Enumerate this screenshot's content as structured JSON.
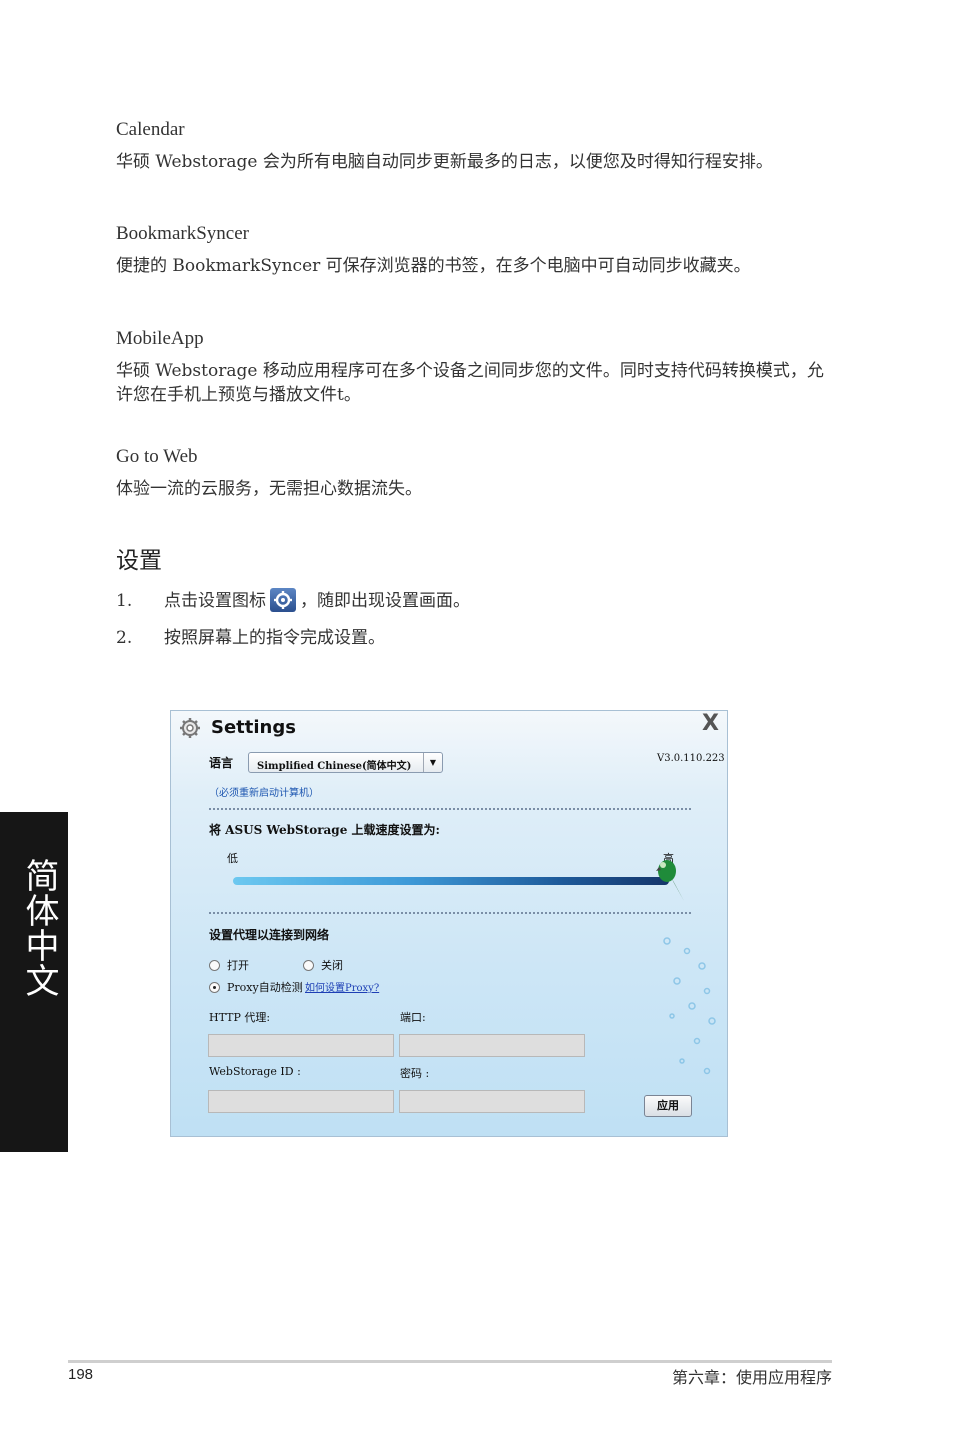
{
  "sections": [
    {
      "title": "Calendar",
      "body": "华硕 Webstorage 会为所有电脑自动同步更新最多的日志，以便您及时得知行程安排。"
    },
    {
      "title": "BookmarkSyncer",
      "body": "便捷的 BookmarkSyncer 可保存浏览器的书签，在多个电脑中可自动同步收藏夹。"
    },
    {
      "title": "MobileApp",
      "body": "华硕 Webstorage 移动应用程序可在多个设备之间同步您的文件。同时支持代码转换模式，允许您在手机上预览与播放文件t。"
    },
    {
      "title": "Go to Web",
      "body": "体验一流的云服务，无需担心数据流失。"
    }
  ],
  "settings_heading": "设置",
  "steps": [
    {
      "num": "1.",
      "before": "点击设置图标",
      "after": "，随即出现设置画面。"
    },
    {
      "num": "2.",
      "text": "按照屏幕上的指令完成设置。"
    }
  ],
  "window": {
    "title": "Settings",
    "close": "X",
    "language_label": "语言",
    "language_value": "Simplified Chinese(简体中文)",
    "version": "V3.0.110.223",
    "restart_note": "（必须重新启动计算机）",
    "upload_label": "将 ASUS WebStorage 上载速度设置为:",
    "slider_low": "低",
    "slider_high": "高",
    "slider_level": 1.0,
    "proxy_heading": "设置代理以连接到网络",
    "radio_on": "打开",
    "radio_off": "关闭",
    "radio_auto": "Proxy自动检测",
    "proxy_help_link": "如何设置Proxy?",
    "http_proxy_label": "HTTP 代理:",
    "port_label": "端口:",
    "webstorage_id_label": "WebStorage ID :",
    "password_label": "密码 :",
    "apply_label": "应用"
  },
  "side_tab": "简体中文",
  "page_number": "198",
  "chapter": "第六章：使用应用程序"
}
